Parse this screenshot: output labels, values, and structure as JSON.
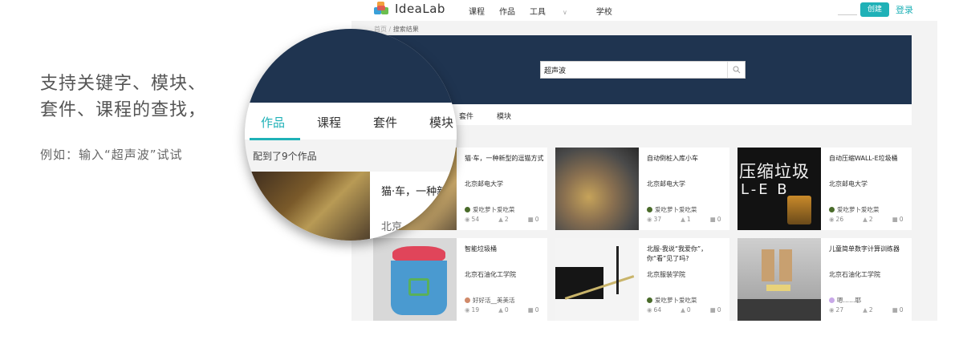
{
  "promo": {
    "headline_line1": "支持关键字、模块、",
    "headline_line2": "套件、课程的查找，",
    "example": "例如：输入“超声波”试试"
  },
  "app": {
    "logo_text": "IdeaLab",
    "nav": {
      "courses": "课程",
      "works": "作品",
      "tools": "工具",
      "schools": "学校"
    },
    "create_label": "创建",
    "login_label": "登录",
    "breadcrumb": {
      "home": "首页",
      "separator": "/",
      "current": "搜索结果"
    },
    "search": {
      "value": "超声波"
    },
    "tabs": {
      "kits": "套件",
      "modules": "模块"
    },
    "accent_color": "#1fb1b7",
    "banner_color": "#1f3450",
    "cards": [
      {
        "title": "猫·车，一种新型的逗猫方式",
        "school": "北京邮电大学",
        "author": "爱吃萝卜爱吃菜",
        "views": "54",
        "likes": "2",
        "comments": "0"
      },
      {
        "title": "自动倒桩入库小车",
        "school": "北京邮电大学",
        "author": "爱吃萝卜爱吃菜",
        "views": "37",
        "likes": "1",
        "comments": "0"
      },
      {
        "title": "自动压缩WALL-E垃圾桶",
        "school": "北京邮电大学",
        "author": "爱吃萝卜爱吃菜",
        "views": "26",
        "likes": "2",
        "comments": "0"
      },
      {
        "title": "智能垃圾桶",
        "school": "北京石油化工学院",
        "author": "好好活__美美活",
        "views": "19",
        "likes": "0",
        "comments": "0"
      },
      {
        "title": "北服-我说“我爱你”，你“看”见了吗?",
        "school": "北京服装学院",
        "author": "爱吃萝卜爱吃菜",
        "views": "64",
        "likes": "0",
        "comments": "0"
      },
      {
        "title": "儿童简单数字计算训练器",
        "school": "北京石油化工学院",
        "author": "嗯……耶",
        "views": "27",
        "likes": "2",
        "comments": "0"
      }
    ],
    "thumb_texts": {
      "card3_line1": "压缩垃圾",
      "card3_line2": "L-E B"
    }
  },
  "magnifier": {
    "tabs": {
      "works": "作品",
      "courses": "课程",
      "kits": "套件",
      "modules": "模块"
    },
    "count_text": "配到了9个作品",
    "card_title": "猫·车，一种新",
    "card_sub": "北京"
  }
}
